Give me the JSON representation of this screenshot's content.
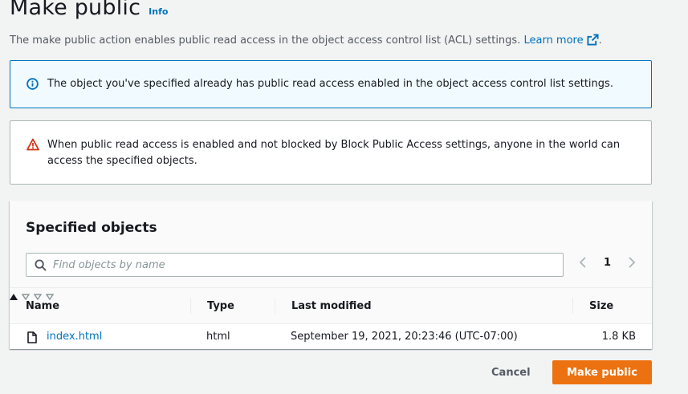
{
  "header": {
    "title": "Make public",
    "info_label": "Info",
    "description": "The make public action enables public read access in the object access control list (ACL) settings.",
    "learn_more": "Learn more"
  },
  "alerts": {
    "info": {
      "icon": "info-icon",
      "text": "The object you've specified already has public read access enabled in the object access control list settings."
    },
    "warning": {
      "icon": "warning-icon",
      "text": "When public read access is enabled and not blocked by Block Public Access settings, anyone in the world can access the specified objects."
    }
  },
  "objects": {
    "title": "Specified objects",
    "search_placeholder": "Find objects by name",
    "search_value": "",
    "page": "1",
    "columns": [
      "Name",
      "Type",
      "Last modified",
      "Size"
    ],
    "rows": [
      {
        "name": "index.html",
        "type": "html",
        "last_modified": "September 19, 2021, 20:23:46 (UTC-07:00)",
        "size": "1.8 KB"
      }
    ]
  },
  "footer": {
    "cancel_label": "Cancel",
    "submit_label": "Make public"
  },
  "colors": {
    "link": "#0073bb",
    "primary": "#ec7211",
    "warning": "#d13212"
  }
}
